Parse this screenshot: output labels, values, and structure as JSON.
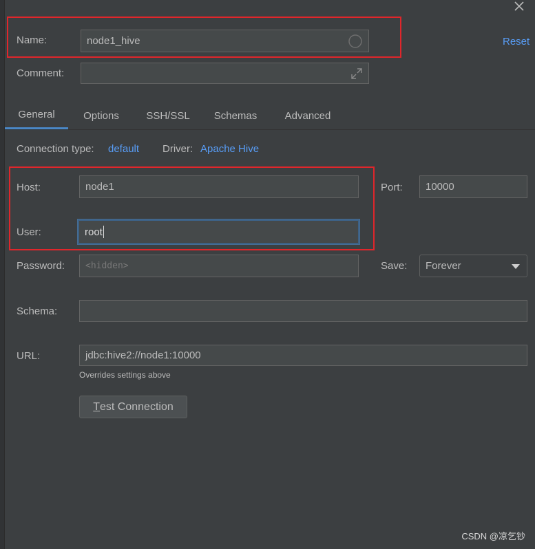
{
  "dialog": {
    "close_icon": "close-icon",
    "reset_label": "Reset"
  },
  "name_row": {
    "label": "Name:",
    "value": "node1_hive",
    "status_icon": "circle-icon"
  },
  "comment_row": {
    "label": "Comment:",
    "value": "",
    "expand_icon": "expand-icon"
  },
  "tabs": [
    {
      "label": "General",
      "active": true
    },
    {
      "label": "Options",
      "active": false
    },
    {
      "label": "SSH/SSL",
      "active": false
    },
    {
      "label": "Schemas",
      "active": false
    },
    {
      "label": "Advanced",
      "active": false
    }
  ],
  "connection": {
    "type_label": "Connection type:",
    "type_value": "default",
    "driver_label": "Driver:",
    "driver_value": "Apache Hive"
  },
  "host": {
    "label": "Host:",
    "value": "node1"
  },
  "port": {
    "label": "Port:",
    "value": "10000"
  },
  "user": {
    "label": "User:",
    "value": "root"
  },
  "password": {
    "label": "Password:",
    "placeholder": "<hidden>"
  },
  "save": {
    "label": "Save:",
    "value": "Forever"
  },
  "schema": {
    "label": "Schema:",
    "value": ""
  },
  "url": {
    "label": "URL:",
    "value": "jdbc:hive2://node1:10000",
    "hint": "Overrides settings above"
  },
  "test_connection": {
    "mnemonic": "T",
    "rest": "est Connection"
  },
  "watermark": "CSDN @凉乞钞",
  "colors": {
    "background": "#3c3f41",
    "field": "#45494a",
    "link": "#589df6",
    "highlight_box": "#e0262b",
    "focus": "#3d6185"
  }
}
